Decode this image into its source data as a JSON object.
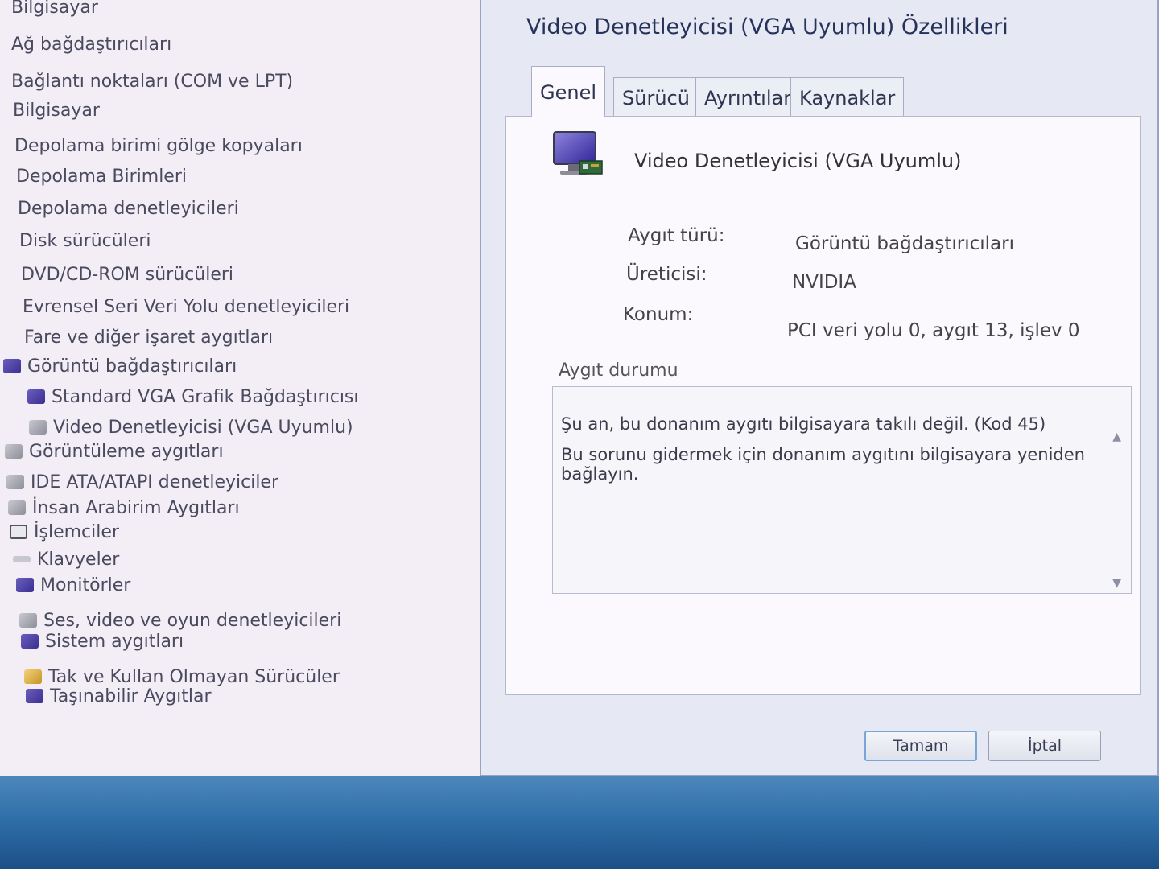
{
  "tree": {
    "items": [
      {
        "label": "Bilgisayar",
        "icon": "computer-icon"
      },
      {
        "label": "Ağ bağdaştırıcıları",
        "icon": "network-icon"
      },
      {
        "label": "Bağlantı noktaları (COM ve LPT)",
        "icon": "port-icon"
      },
      {
        "label": "Bilgisayar",
        "icon": "computer-icon"
      },
      {
        "label": "Depolama birimi gölge kopyaları",
        "icon": "storage-icon"
      },
      {
        "label": "Depolama Birimleri",
        "icon": "storage-icon"
      },
      {
        "label": "Depolama denetleyicileri",
        "icon": "storage-controller-icon"
      },
      {
        "label": "Disk sürücüleri",
        "icon": "disk-icon"
      },
      {
        "label": "DVD/CD-ROM sürücüleri",
        "icon": "dvd-icon"
      },
      {
        "label": "Evrensel Seri Veri Yolu denetleyicileri",
        "icon": "usb-icon"
      },
      {
        "label": "Fare ve diğer işaret aygıtları",
        "icon": "mouse-icon"
      },
      {
        "label": "Görüntü bağdaştırıcıları",
        "icon": "display-adapter-icon"
      },
      {
        "label": "Standard VGA Grafik Bağdaştırıcısı",
        "icon": "display-adapter-icon"
      },
      {
        "label": "Video Denetleyicisi (VGA Uyumlu)",
        "icon": "display-adapter-warning-icon"
      },
      {
        "label": "Görüntüleme aygıtları",
        "icon": "imaging-icon"
      },
      {
        "label": "IDE ATA/ATAPI denetleyiciler",
        "icon": "ide-icon"
      },
      {
        "label": "İnsan Arabirim Aygıtları",
        "icon": "hid-icon"
      },
      {
        "label": "İşlemciler",
        "icon": "processor-icon"
      },
      {
        "label": "Klavyeler",
        "icon": "keyboard-icon"
      },
      {
        "label": "Monitörler",
        "icon": "monitor-icon"
      },
      {
        "label": "Ses, video ve oyun denetleyicileri",
        "icon": "sound-icon"
      },
      {
        "label": "Sistem aygıtları",
        "icon": "system-icon"
      },
      {
        "label": "Tak ve Kullan Olmayan Sürücüler",
        "icon": "non-pnp-icon"
      },
      {
        "label": "Taşınabilir Aygıtlar",
        "icon": "portable-device-icon"
      }
    ]
  },
  "dialog": {
    "title": "Video Denetleyicisi (VGA Uyumlu) Özellikleri",
    "tabs": [
      "Genel",
      "Sürücü",
      "Ayrıntılar",
      "Kaynaklar"
    ],
    "active_tab": "Genel",
    "device_name": "Video Denetleyicisi (VGA Uyumlu)",
    "properties": {
      "type_label": "Aygıt türü:",
      "type_value": "Görüntü bağdaştırıcıları",
      "manufacturer_label": "Üreticisi:",
      "manufacturer_value": "NVIDIA",
      "location_label": "Konum:",
      "location_value": "PCI veri yolu 0, aygıt 13, işlev 0"
    },
    "status_group_label": "Aygıt durumu",
    "status_lines": [
      "Şu an, bu donanım aygıtı bilgisayara takılı değil. (Kod 45)",
      "Bu sorunu gidermek için donanım aygıtını bilgisayara yeniden",
      "bağlayın."
    ],
    "ok_label": "Tamam",
    "cancel_label": "İptal"
  },
  "colors": {
    "accent": "#78a7d6",
    "desktop": "#2f6fa9"
  }
}
